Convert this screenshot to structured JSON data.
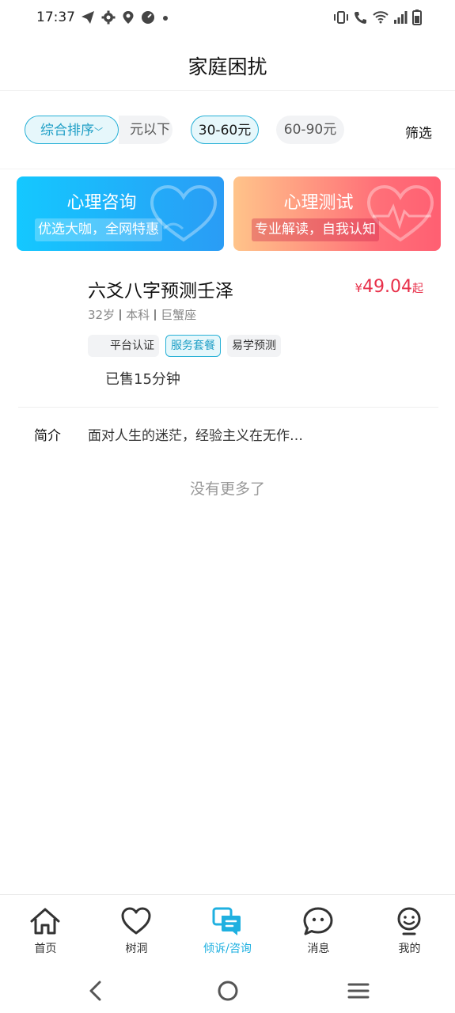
{
  "status_bar": {
    "time": "17:37",
    "left_icons": [
      "telegram-icon",
      "gear-icon",
      "location-icon",
      "speed-icon",
      "dot-icon"
    ],
    "right_icons": [
      "vibrate-icon",
      "wifi-call-icon",
      "wifi-icon",
      "signal-icon",
      "battery-icon"
    ]
  },
  "header": {
    "title": "家庭困扰"
  },
  "filters": {
    "sort_label": "综合排序",
    "chips": [
      "元以下",
      "30-60元",
      "60-90元"
    ],
    "filter_label": "筛选"
  },
  "banners": [
    {
      "title": "心理咨询",
      "subtitle": "优选大咖，全网特惠",
      "art": "heart-icon"
    },
    {
      "title": "心理测试",
      "subtitle": "专业解读，自我认知",
      "art": "heartbeat-icon"
    }
  ],
  "card": {
    "name": "六爻八字预测壬泽",
    "price_currency": "¥",
    "price_value": "49.04",
    "price_suffix": "起",
    "meta": [
      "32岁",
      "本科",
      "巨蟹座"
    ],
    "tags": [
      "平台认证",
      "服务套餐",
      "易学预测"
    ],
    "sold": "已售15分钟"
  },
  "intro": {
    "label": "简介",
    "text": "面对人生的迷茫，经验主义在无作…"
  },
  "no_more": "没有更多了",
  "tabs": [
    {
      "label": "首页",
      "icon": "home-icon"
    },
    {
      "label": "树洞",
      "icon": "heart-outline-icon"
    },
    {
      "label": "倾诉/咨询",
      "icon": "chat-icon"
    },
    {
      "label": "消息",
      "icon": "message-icon"
    },
    {
      "label": "我的",
      "icon": "profile-icon"
    }
  ],
  "colors": {
    "accent": "#1fb0e0",
    "price": "#e8304a"
  }
}
